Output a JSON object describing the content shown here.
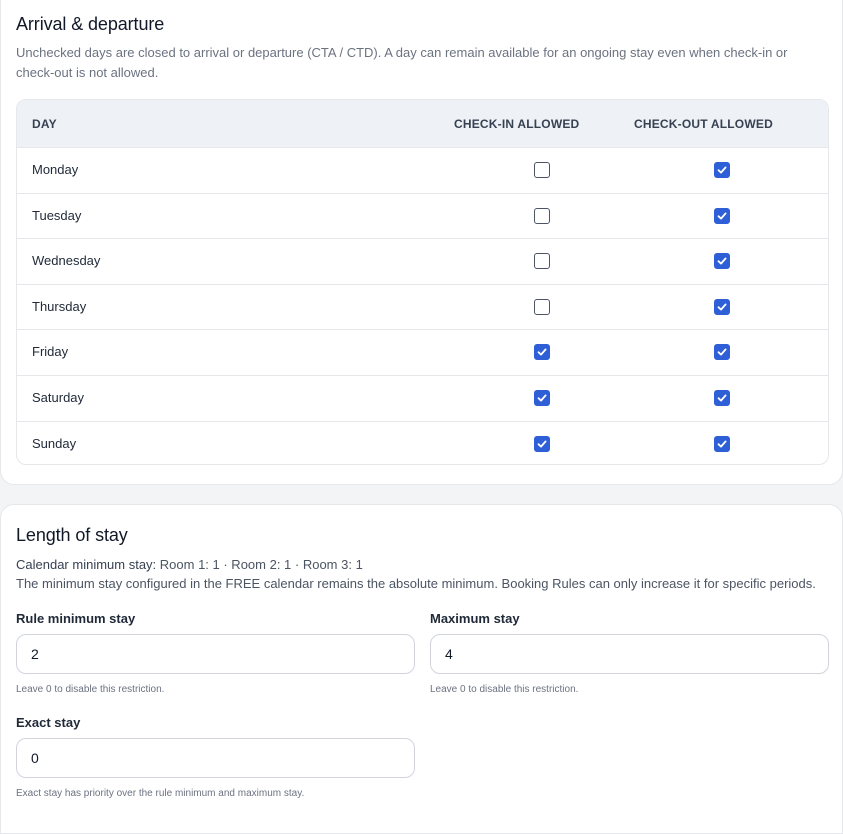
{
  "arrival": {
    "title": "Arrival & departure",
    "description": "Unchecked days are closed to arrival or departure (CTA / CTD). A day can remain available for an ongoing stay even when check-in or check-out is not allowed.",
    "columns": {
      "day": "DAY",
      "check_in": "CHECK-IN ALLOWED",
      "check_out": "CHECK-OUT ALLOWED"
    },
    "rows": [
      {
        "day": "Monday",
        "check_in": false,
        "check_out": true
      },
      {
        "day": "Tuesday",
        "check_in": false,
        "check_out": true
      },
      {
        "day": "Wednesday",
        "check_in": false,
        "check_out": true
      },
      {
        "day": "Thursday",
        "check_in": false,
        "check_out": true
      },
      {
        "day": "Friday",
        "check_in": true,
        "check_out": true
      },
      {
        "day": "Saturday",
        "check_in": true,
        "check_out": true
      },
      {
        "day": "Sunday",
        "check_in": true,
        "check_out": true
      }
    ]
  },
  "length_of_stay": {
    "title": "Length of stay",
    "calendar_label": "Calendar minimum stay:",
    "calendar_value": "Room 1: 1 · Room 2: 1 · Room 3: 1",
    "note": "The minimum stay configured in the FREE calendar remains the absolute minimum. Booking Rules can only increase it for specific periods.",
    "rule_min": {
      "label": "Rule minimum stay",
      "value": "2",
      "hint": "Leave 0 to disable this restriction."
    },
    "max": {
      "label": "Maximum stay",
      "value": "4",
      "hint": "Leave 0 to disable this restriction."
    },
    "exact": {
      "label": "Exact stay",
      "value": "0",
      "hint": "Exact stay has priority over the rule minimum and maximum stay."
    }
  },
  "colors": {
    "accent": "#2f5fd6",
    "header_bg": "#eef2f7"
  }
}
